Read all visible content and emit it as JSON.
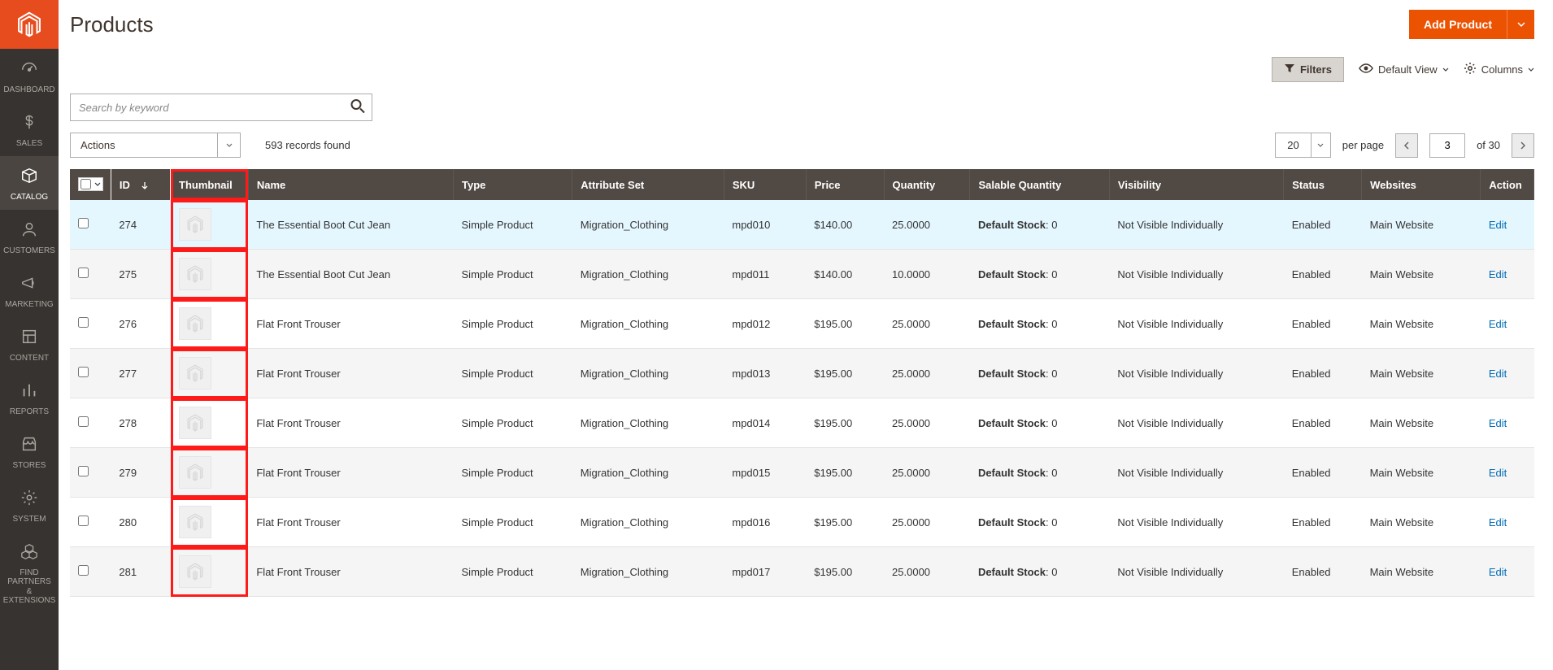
{
  "page_title": "Products",
  "add_button": "Add Product",
  "toolbar": {
    "filters": "Filters",
    "default_view": "Default View",
    "columns": "Columns"
  },
  "search": {
    "placeholder": "Search by keyword"
  },
  "actions_dd": "Actions",
  "records_found": "593 records found",
  "per_page_value": "20",
  "per_page_label": "per page",
  "current_page": "3",
  "total_pages_label": "of 30",
  "sidebar": [
    {
      "label": "DASHBOARD",
      "icon": "gauge"
    },
    {
      "label": "SALES",
      "icon": "dollar"
    },
    {
      "label": "CATALOG",
      "icon": "box",
      "active": true
    },
    {
      "label": "CUSTOMERS",
      "icon": "person"
    },
    {
      "label": "MARKETING",
      "icon": "megaphone"
    },
    {
      "label": "CONTENT",
      "icon": "blocks"
    },
    {
      "label": "REPORTS",
      "icon": "chart"
    },
    {
      "label": "STORES",
      "icon": "store"
    },
    {
      "label": "SYSTEM",
      "icon": "gear"
    },
    {
      "label": "FIND PARTNERS\n& EXTENSIONS",
      "icon": "cubes"
    }
  ],
  "columns": {
    "id": "ID",
    "thumbnail": "Thumbnail",
    "name": "Name",
    "type": "Type",
    "attribute_set": "Attribute Set",
    "sku": "SKU",
    "price": "Price",
    "quantity": "Quantity",
    "salable": "Salable Quantity",
    "visibility": "Visibility",
    "status": "Status",
    "websites": "Websites",
    "action": "Action"
  },
  "salable_label": "Default Stock",
  "edit_label": "Edit",
  "rows": [
    {
      "id": "274",
      "name": "The Essential Boot Cut Jean",
      "type": "Simple Product",
      "attr": "Migration_Clothing",
      "sku": "mpd010",
      "price": "$140.00",
      "qty": "25.0000",
      "sal": "0",
      "vis": "Not Visible Individually",
      "status": "Enabled",
      "web": "Main Website",
      "hover": true
    },
    {
      "id": "275",
      "name": "The Essential Boot Cut Jean",
      "type": "Simple Product",
      "attr": "Migration_Clothing",
      "sku": "mpd011",
      "price": "$140.00",
      "qty": "10.0000",
      "sal": "0",
      "vis": "Not Visible Individually",
      "status": "Enabled",
      "web": "Main Website"
    },
    {
      "id": "276",
      "name": "Flat Front Trouser",
      "type": "Simple Product",
      "attr": "Migration_Clothing",
      "sku": "mpd012",
      "price": "$195.00",
      "qty": "25.0000",
      "sal": "0",
      "vis": "Not Visible Individually",
      "status": "Enabled",
      "web": "Main Website"
    },
    {
      "id": "277",
      "name": "Flat Front Trouser",
      "type": "Simple Product",
      "attr": "Migration_Clothing",
      "sku": "mpd013",
      "price": "$195.00",
      "qty": "25.0000",
      "sal": "0",
      "vis": "Not Visible Individually",
      "status": "Enabled",
      "web": "Main Website"
    },
    {
      "id": "278",
      "name": "Flat Front Trouser",
      "type": "Simple Product",
      "attr": "Migration_Clothing",
      "sku": "mpd014",
      "price": "$195.00",
      "qty": "25.0000",
      "sal": "0",
      "vis": "Not Visible Individually",
      "status": "Enabled",
      "web": "Main Website"
    },
    {
      "id": "279",
      "name": "Flat Front Trouser",
      "type": "Simple Product",
      "attr": "Migration_Clothing",
      "sku": "mpd015",
      "price": "$195.00",
      "qty": "25.0000",
      "sal": "0",
      "vis": "Not Visible Individually",
      "status": "Enabled",
      "web": "Main Website"
    },
    {
      "id": "280",
      "name": "Flat Front Trouser",
      "type": "Simple Product",
      "attr": "Migration_Clothing",
      "sku": "mpd016",
      "price": "$195.00",
      "qty": "25.0000",
      "sal": "0",
      "vis": "Not Visible Individually",
      "status": "Enabled",
      "web": "Main Website"
    },
    {
      "id": "281",
      "name": "Flat Front Trouser",
      "type": "Simple Product",
      "attr": "Migration_Clothing",
      "sku": "mpd017",
      "price": "$195.00",
      "qty": "25.0000",
      "sal": "0",
      "vis": "Not Visible Individually",
      "status": "Enabled",
      "web": "Main Website"
    }
  ]
}
